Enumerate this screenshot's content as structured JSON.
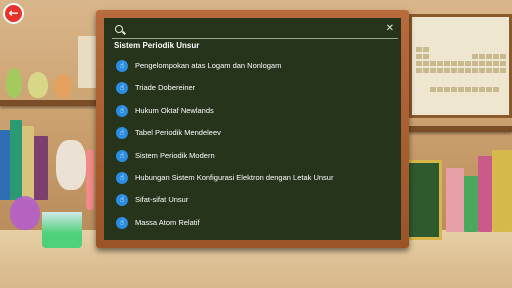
{
  "header": {
    "back_icon": "back-arrow-icon"
  },
  "search": {
    "placeholder": "",
    "value": "",
    "search_icon": "search-icon",
    "close_icon": "close-icon"
  },
  "menu": {
    "title": "Sistem Periodik Unsur",
    "items": [
      {
        "label": "Pengelompokan atas Logam dan Nonlogam",
        "icon": "hand-pointer-icon"
      },
      {
        "label": "Triade Dobereiner",
        "icon": "hand-pointer-icon"
      },
      {
        "label": "Hukum Oktaf Newlands",
        "icon": "hand-pointer-icon"
      },
      {
        "label": "Tabel Periodik Mendeleev",
        "icon": "hand-pointer-icon"
      },
      {
        "label": "Sistem Periodik Modern",
        "icon": "hand-pointer-icon"
      },
      {
        "label": "Hubungan Sistem Konfigurasi Elektron dengan Letak Unsur",
        "icon": "hand-pointer-icon"
      },
      {
        "label": "Sifat-sifat Unsur",
        "icon": "hand-pointer-icon"
      },
      {
        "label": "Massa Atom Relatif",
        "icon": "hand-pointer-icon"
      }
    ]
  },
  "colors": {
    "board": "#26341b",
    "frame": "#a85d2e",
    "bullet": "#2a8de0",
    "back_button": "#e8322b"
  }
}
